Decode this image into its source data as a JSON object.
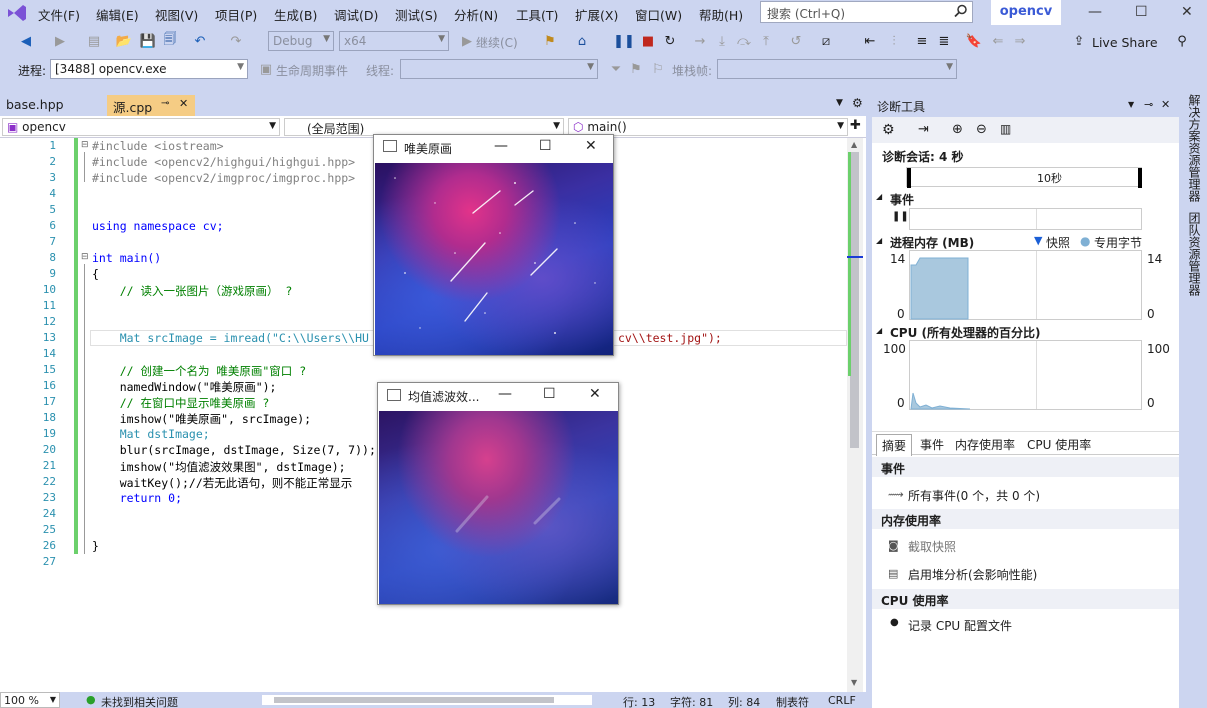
{
  "menubar": {
    "items": [
      "文件(F)",
      "编辑(E)",
      "视图(V)",
      "项目(P)",
      "生成(B)",
      "调试(D)",
      "测试(S)",
      "分析(N)",
      "工具(T)",
      "扩展(X)",
      "窗口(W)",
      "帮助(H)"
    ],
    "search_placeholder": "搜索 (Ctrl+Q)",
    "solution_badge": "opencv"
  },
  "toolbar": {
    "config": "Debug",
    "platform": "x64",
    "continue_label": "继续(C)",
    "live_share": "Live Share"
  },
  "toolbar2": {
    "process_label": "进程:",
    "process_value": "[3488] opencv.exe",
    "lifecycle_label": "生命周期事件",
    "thread_label": "线程:",
    "stackframe_label": "堆栈帧:"
  },
  "tabs": [
    "base.hpp",
    "源.cpp"
  ],
  "nav": {
    "project": "opencv",
    "scope": "(全局范围)",
    "member": "main()"
  },
  "code": {
    "line_numbers": [
      "1",
      "2",
      "3",
      "4",
      "5",
      "6",
      "7",
      "8",
      "9",
      "10",
      "11",
      "12",
      "13",
      "14",
      "15",
      "16",
      "17",
      "18",
      "19",
      "20",
      "21",
      "22",
      "23",
      "24",
      "25",
      "26",
      "27"
    ],
    "lines": [
      "#include <iostream>",
      "#include <opencv2/highgui/highgui.hpp>",
      "#include <opencv2/imgproc/imgproc.hpp>",
      "",
      "",
      "using namespace cv;",
      "",
      "int main()",
      "{",
      "    // 读入一张图片（游戏原画） ?",
      "",
      "",
      "    Mat srcImage = imread(\"C:\\\\Users\\\\HU",
      "",
      "    // 创建一个名为 唯美原画\"窗口 ?",
      "    namedWindow(\"唯美原画\");",
      "    // 在窗口中显示唯美原画 ?",
      "    imshow(\"唯美原画\", srcImage);",
      "    Mat dstImage;",
      "    blur(srcImage, dstImage, Size(7, 7));",
      "    imshow(\"均值滤波效果图\", dstImage);",
      "    waitKey();//若无此语句，则不能正常显示",
      "    return 0;",
      "",
      "",
      "}",
      ""
    ],
    "line13_tail": "cv\\\\test.jpg\");"
  },
  "windows": {
    "original_title": "唯美原画",
    "blur_title": "均值滤波效..."
  },
  "statusbar": {
    "zoom": "100 %",
    "issues": "未找到相关问题",
    "line": "行: 13",
    "char": "字符: 81",
    "col": "列: 84",
    "tab": "制表符",
    "eol": "CRLF"
  },
  "diag": {
    "title": "诊断工具",
    "session": "诊断会话: 4 秒",
    "timeline_label": "10秒",
    "events_section": "事件",
    "memory_section": "进程内存 (MB)",
    "legend_snapshot": "快照",
    "legend_private": "专用字节",
    "mem_max": "14",
    "mem_min": "0",
    "cpu_section": "CPU (所有处理器的百分比)",
    "cpu_max": "100",
    "cpu_min": "0",
    "tabs": [
      "摘要",
      "事件",
      "内存使用率",
      "CPU 使用率"
    ],
    "summary_events_head": "事件",
    "all_events": "所有事件(0 个，共 0 个)",
    "memory_head": "内存使用率",
    "take_snapshot": "截取快照",
    "heap_analysis": "启用堆分析(会影响性能)",
    "cpu_head": "CPU 使用率",
    "record_cpu": "记录 CPU 配置文件"
  },
  "sidebar": {
    "solution_explorer": "解决方案资源管理器",
    "team_explorer": "团队资源管理器"
  }
}
